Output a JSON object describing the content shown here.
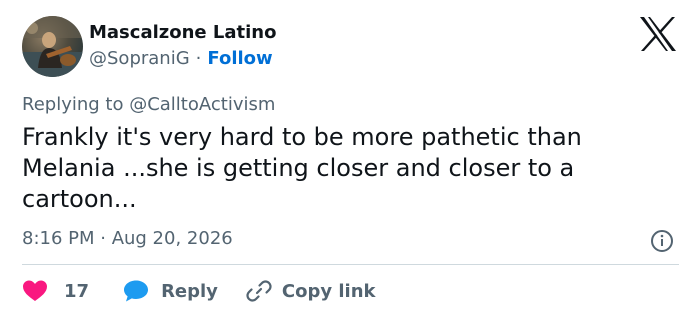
{
  "author": {
    "name": "Mascalzone Latino",
    "handle": "@SopraniG",
    "separator": "·",
    "follow_label": "Follow"
  },
  "reply_context": {
    "text": "Replying to @CalltoActivism"
  },
  "tweet": {
    "text": "Frankly it's very hard to be more pathetic than Melania ...she is getting closer and closer to a cartoon...",
    "timestamp": "8:16 PM · Aug 20, 2026"
  },
  "actions": {
    "like_count": "17",
    "reply_label": "Reply",
    "copy_label": "Copy link"
  },
  "icons": {
    "logo": "x-logo-icon",
    "info": "info-icon",
    "like": "heart-icon",
    "reply": "speech-bubble-icon",
    "copy": "link-icon"
  },
  "colors": {
    "like": "#f91880",
    "reply": "#1d9bf0",
    "follow": "#006fd6",
    "muted": "#536471",
    "text": "#0f1419"
  }
}
